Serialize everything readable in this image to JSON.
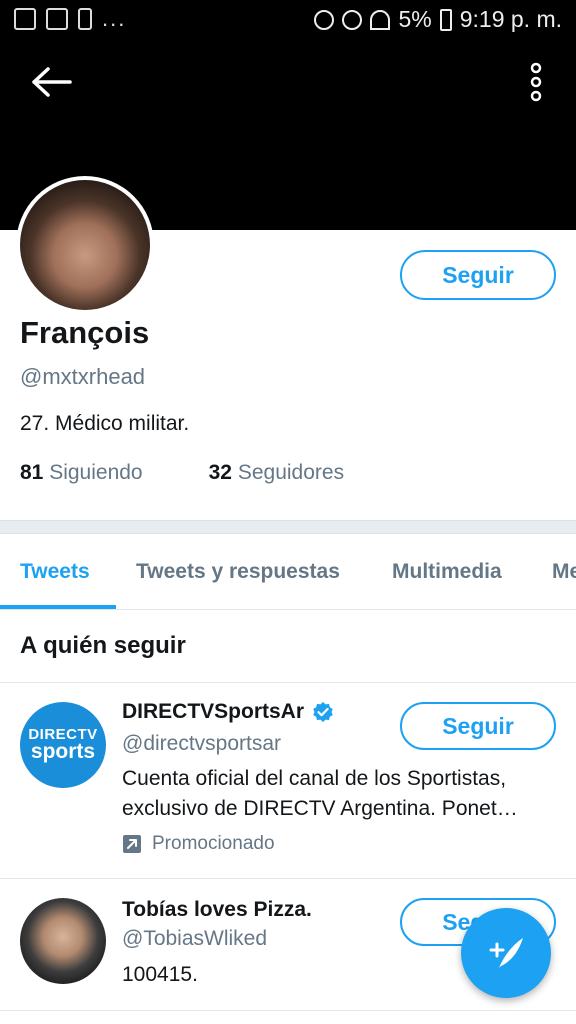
{
  "status_bar": {
    "battery": "5%",
    "time": "9:19 p. m.",
    "notif_more": "..."
  },
  "profile": {
    "display_name": "François",
    "handle": "@mxtxrhead",
    "bio": "27. Médico militar.",
    "following_count": "81",
    "following_label": "Siguiendo",
    "followers_count": "32",
    "followers_label": "Seguidores",
    "follow_label": "Seguir"
  },
  "tabs": [
    {
      "label": "Tweets",
      "active": true
    },
    {
      "label": "Tweets y respuestas",
      "active": false
    },
    {
      "label": "Multimedia",
      "active": false
    },
    {
      "label": "Me",
      "active": false
    }
  ],
  "who_to_follow": {
    "title": "A quién seguir",
    "items": [
      {
        "name": "DIRECTVSportsAr",
        "handle": "@directvsportsar",
        "verified": true,
        "desc_line1": "Cuenta oficial del canal de los Sportistas,",
        "desc_line2": "exclusivo de DIRECTV Argentina. Ponet…",
        "promoted_label": "Promocionado",
        "follow_label": "Seguir",
        "avatar_text_1": "DIRECTV",
        "avatar_text_2": "sports"
      },
      {
        "name": "Tobías loves Pizza.",
        "handle": "@TobiasWliked",
        "desc": "100415.",
        "follow_label": "Seguir"
      }
    ]
  },
  "colors": {
    "accent": "#1da1f2",
    "muted_text": "#657786",
    "header_bg": "#000000"
  },
  "icons": {
    "back": "arrow-left-icon",
    "more": "vertical-ellipsis-icon",
    "verified": "verified-badge-icon",
    "promoted": "promoted-arrow-icon",
    "compose": "compose-tweet-icon"
  }
}
